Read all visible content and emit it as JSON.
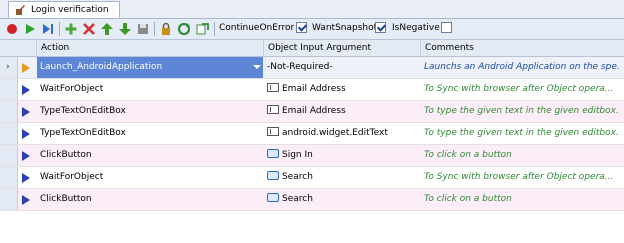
{
  "tab": {
    "title": "Login verification",
    "icon": "script-edit-icon"
  },
  "toolbar": {
    "buttons": [
      {
        "name": "stop-icon",
        "color": "#d32020"
      },
      {
        "name": "run-icon",
        "color": "#2ea02e"
      },
      {
        "name": "step-icon",
        "color": "#2a6fd6"
      },
      {
        "name": "add-icon",
        "color": "#4aa83a"
      },
      {
        "name": "delete-icon",
        "color": "#d33030"
      },
      {
        "name": "move-up-icon",
        "color": "#3f9a2a"
      },
      {
        "name": "move-down-icon",
        "color": "#3f9a2a"
      },
      {
        "name": "save-icon",
        "color": "#8a8a8a"
      },
      {
        "name": "lock-icon",
        "color": "#c98e1a"
      },
      {
        "name": "refresh-icon",
        "color": "#2f8a3a"
      },
      {
        "name": "export-icon",
        "color": "#3a8a3a"
      }
    ],
    "continue_on_error": {
      "label": "ContinueOnError",
      "checked": true
    },
    "want_snapshot": {
      "label": "WantSnapshot",
      "checked": true
    },
    "is_negative": {
      "label": "IsNegative",
      "checked": false
    }
  },
  "grid": {
    "columns": [
      "Action",
      "Object Input Argument",
      "Comments"
    ],
    "rows": [
      {
        "action": "Launch_AndroidApplication",
        "arg": "-Not-Required-",
        "arg_icon": "",
        "comment": "Launchs an Android Application on the spe...",
        "selected": true
      },
      {
        "action": "WaitForObject",
        "arg": "Email Address",
        "arg_icon": "editbox-icon",
        "comment": "To Sync with browser after Object opera...",
        "selected": false
      },
      {
        "action": "TypeTextOnEditBox",
        "arg": "Email Address",
        "arg_icon": "editbox-icon",
        "comment": "To type the given text in the given editbox.",
        "selected": false
      },
      {
        "action": "TypeTextOnEditBox",
        "arg": "android.widget.EditText",
        "arg_icon": "editbox-icon",
        "comment": "To type the given text in the given editbox.",
        "selected": false
      },
      {
        "action": "ClickButton",
        "arg": "Sign In",
        "arg_icon": "button-icon",
        "comment": "To click on a button",
        "selected": false
      },
      {
        "action": "WaitForObject",
        "arg": "Search",
        "arg_icon": "button-icon",
        "comment": "To Sync with browser after Object opera...",
        "selected": false
      },
      {
        "action": "ClickButton",
        "arg": "Search",
        "arg_icon": "button-icon",
        "comment": "To click on a button",
        "selected": false
      }
    ]
  }
}
